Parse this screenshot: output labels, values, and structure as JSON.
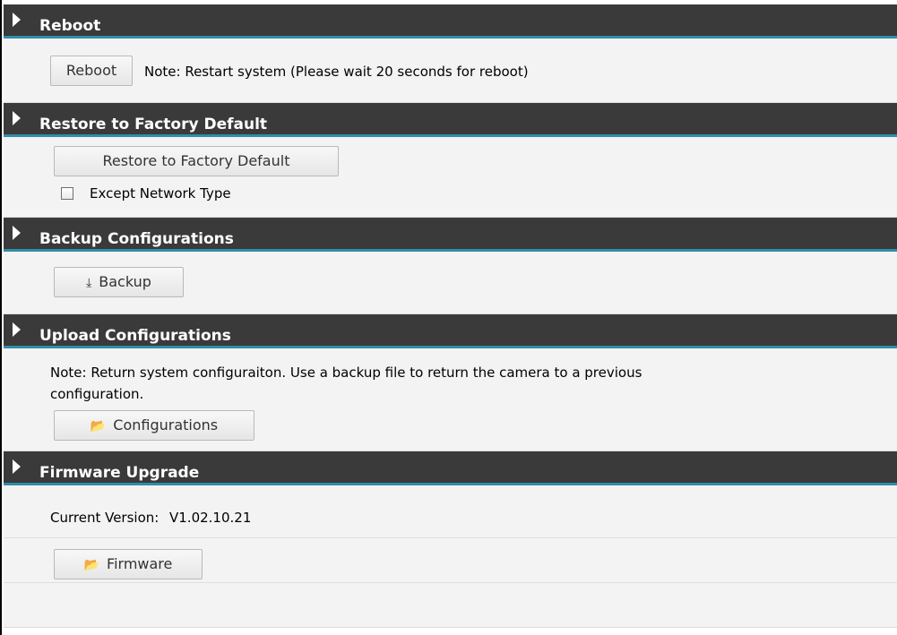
{
  "sections": {
    "reboot": {
      "title": "Reboot",
      "button_label": "Reboot",
      "note": "Note: Restart system (Please wait 20 seconds for reboot)"
    },
    "restore": {
      "title": "Restore to Factory Default",
      "button_label": "Restore to Factory Default",
      "checkbox_label": "Except Network Type",
      "checkbox_checked": false
    },
    "backup": {
      "title": "Backup Configurations",
      "button_label": "Backup",
      "button_icon": "download-icon"
    },
    "upload": {
      "title": "Upload Configurations",
      "note_line1": "Note: Return system configuraiton. Use a backup file to return the camera to a previous",
      "note_line2": "configuration.",
      "button_label": "Configurations",
      "button_icon": "folder-open-icon"
    },
    "firmware": {
      "title": "Firmware Upgrade",
      "current_version_label": "Current Version:",
      "current_version": "V1.02.10.21",
      "button_label": "Firmware",
      "button_icon": "folder-open-icon"
    }
  },
  "colors": {
    "header_bg": "#3a3a3a",
    "header_accent": "#2f8ea6",
    "body_bg": "#f3f3f3"
  }
}
